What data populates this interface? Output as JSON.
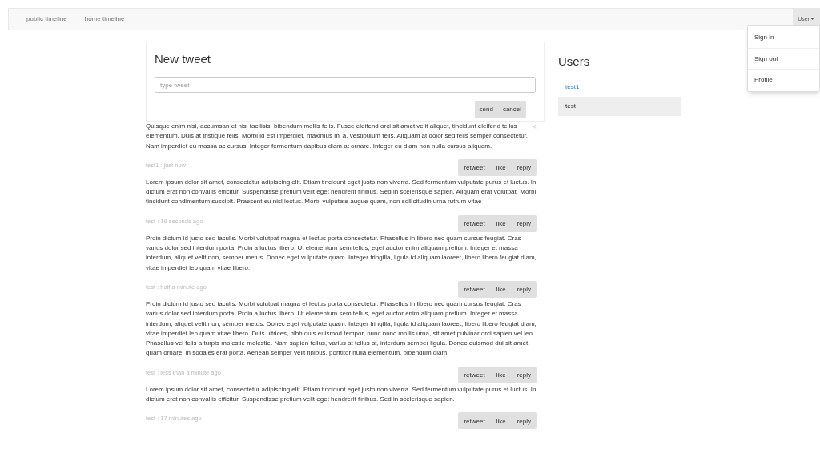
{
  "navbar": {
    "links": [
      "public timeline",
      "home timeline"
    ],
    "user_menu": {
      "label": "User",
      "expanded": true,
      "items": [
        "Sign in",
        "Sign out",
        "Profile"
      ]
    }
  },
  "new_tweet": {
    "title": "New tweet",
    "placeholder": "type tweet",
    "buttons": [
      "send",
      "cancel"
    ]
  },
  "feed": {
    "close": "×",
    "posts": [
      {
        "text": "Quisque enim nisi, accumsan et nisl facilisis, bibendum mollis felis. Fusce eleifend orci sit amet velit aliquet, tincidunt eleifend tellus elementum. Duis at tristique felis. Morbi id est imperdiet, maximus mi a, vestibulum felis. Aliquam at dolor sed felis semper consectetur. Nam imperdiet eu massa ac cursus. Integer fermentum dapibus diam at ornare. Integer eu diam non nulla cursus aliquam."
      },
      {
        "meta": "test1 : just now",
        "actions": [
          "retweet",
          "like",
          "reply"
        ],
        "text": "Lorem ipsum dolor sit amet, consectetur adipiscing elit. Etiam tincidunt eget justo non viverra. Sed fermentum vulputate purus et luctus. In dictum erat non convallis efficitur. Suspendisse pretium velit eget hendrerit finibus. Sed in scelerisque sapien. Aliquam erat volutpat. Morbi tincidunt condimentum suscipit. Praesent eu nisl lectus. Morbi vulputate augue quam, non sollicitudin urna rutrum vitae"
      },
      {
        "meta": "test : 19 seconds ago",
        "actions": [
          "retweet",
          "like",
          "reply"
        ],
        "text": "Proin dictum id justo sed iaculis. Morbi volutpat magna et lectus porta consectetur. Phasellus in libero nec quam cursus feugiat. Cras varius dolor sed interdum porta. Proin a luctus libero. Ut elementum sem tellus, eget auctor enim aliquam pretium. Integer et massa interdum, aliquet velit non, semper metus. Donec eget vulputate quam. Integer fringilla, ligula id aliquam laoreet, libero libero feugiat diam, vitae imperdiet leo quam vitae libero."
      },
      {
        "meta": "test : half a minute ago",
        "actions": [
          "retweet",
          "like",
          "reply"
        ],
        "text": "Proin dictum id justo sed iaculis. Morbi volutpat magna et lectus porta consectetur. Phasellus in libero nec quam cursus feugiat. Cras varius dolor sed interdum porta. Proin a luctus libero. Ut elementum sem tellus, eget auctor enim aliquam pretium. Integer et massa interdum, aliquet velit non, semper metus. Donec eget vulputate quam. Integer fringilla, ligula id aliquam laoreet, libero libero feugiat diam, vitae imperdiet leo quam vitae libero. Duis ultrices, nibh quis euismod tempor, nunc nunc mollis urna, sit amet pulvinar orci sapien vel leo. Phasellus vel felis a turpis molestie molestie. Nam sapien tellus, varius at tellus at, interdum semper ligula. Donec euismod dui sit amet quam ornare, in sodales erat porta. Aenean semper velit finibus, porttitor nulla elementum, bibendum diam"
      },
      {
        "meta": "test : less than a minute ago",
        "actions": [
          "retweet",
          "like",
          "reply"
        ],
        "text": "Lorem ipsum dolor sit amet, consectetur adipiscing elit. Etiam tincidunt eget justo non viverra. Sed fermentum vulputate purus et luctus. In dictum erat non convallis efficitur. Suspendisse pretium velit eget hendrerit finibus. Sed in scelerisque sapien."
      },
      {
        "meta": "test : 17 minutes ago",
        "actions": [
          "retweet",
          "like",
          "reply"
        ]
      }
    ]
  },
  "users": {
    "title": "Users",
    "items": [
      {
        "name": "test1",
        "selected": false
      },
      {
        "name": "test",
        "selected": true
      }
    ]
  }
}
